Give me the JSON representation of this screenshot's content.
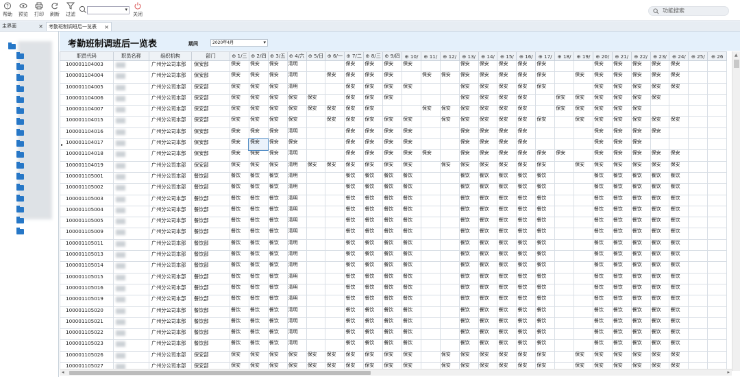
{
  "toolbar": {
    "buttons": [
      {
        "label": "帮助",
        "icon": "help-icon"
      },
      {
        "label": "预览",
        "icon": "eye-icon"
      },
      {
        "label": "打印",
        "icon": "printer-icon"
      },
      {
        "label": "刷新",
        "icon": "refresh-icon"
      },
      {
        "label": "过滤",
        "icon": "filter-icon"
      }
    ],
    "close_label": "关闭",
    "search_value": "",
    "func_search_placeholder": "功能搜索"
  },
  "tabs": [
    {
      "label": "主界面",
      "active": false
    },
    {
      "label": "考勤班制调班后一览表",
      "active": true
    }
  ],
  "page": {
    "title": "考勤班制调班后一览表",
    "filter_label": "期间",
    "filter_value": "2020年4月"
  },
  "columns": [
    "职员代码",
    "职员名称",
    "组织机构",
    "部门",
    "1/三",
    "2/四",
    "3/五",
    "4/六",
    "5/日",
    "6/一",
    "7/二",
    "8/三",
    "9/四",
    "10/",
    "11/",
    "12/",
    "13/",
    "14/",
    "15/",
    "16/",
    "17/",
    "18/",
    "19/",
    "20/",
    "21/",
    "22/",
    "23/",
    "24/",
    "25/",
    "26"
  ],
  "rows": [
    {
      "code": "100001104003",
      "org": "广州分公司本部",
      "dept": "保安部",
      "days": [
        "保安",
        "保安",
        "保安",
        "清明",
        "",
        "",
        "保安",
        "保安",
        "保安",
        "保安",
        "",
        "",
        "保安",
        "保安",
        "保安",
        "保安",
        "保安",
        "",
        "",
        "保安",
        "保安",
        "保安",
        "保安",
        "保安",
        "",
        ""
      ]
    },
    {
      "code": "100001104004",
      "org": "广州分公司本部",
      "dept": "保安部",
      "days": [
        "保安",
        "保安",
        "保安",
        "清明",
        "",
        "保安",
        "保安",
        "保安",
        "保安",
        "",
        "保安",
        "保安",
        "保安",
        "保安",
        "保安",
        "保安",
        "保安",
        "",
        "保安",
        "保安",
        "保安",
        "保安",
        "保安",
        "保安",
        "",
        ""
      ]
    },
    {
      "code": "100001104005",
      "org": "广州分公司本部",
      "dept": "保安部",
      "days": [
        "保安",
        "保安",
        "保安",
        "清明",
        "",
        "",
        "保安",
        "保安",
        "保安",
        "保安",
        "",
        "",
        "保安",
        "保安",
        "保安",
        "保安",
        "保安",
        "",
        "",
        "保安",
        "保安",
        "保安",
        "保安",
        "保安",
        "",
        ""
      ]
    },
    {
      "code": "100001104006",
      "org": "广州分公司本部",
      "dept": "保安部",
      "days": [
        "保安",
        "保安",
        "保安",
        "保安",
        "保安",
        "",
        "保安",
        "保安",
        "保安",
        "",
        "",
        "",
        "保安",
        "保安",
        "保安",
        "保安",
        "",
        "保安",
        "保安",
        "保安",
        "保安",
        "保安",
        "保安",
        "",
        "",
        ""
      ]
    },
    {
      "code": "100001104007",
      "org": "广州分公司本部",
      "dept": "保安部",
      "days": [
        "保安",
        "保安",
        "保安",
        "保安",
        "保安",
        "保安",
        "保安",
        "保安",
        "",
        "",
        "保安",
        "保安",
        "保安",
        "保安",
        "保安",
        "保安",
        "",
        "保安",
        "保安",
        "保安",
        "保安",
        "保安",
        "",
        "",
        "",
        ""
      ]
    },
    {
      "code": "100001104015",
      "org": "广州分公司本部",
      "dept": "保安部",
      "days": [
        "保安",
        "保安",
        "保安",
        "保安",
        "",
        "保安",
        "保安",
        "保安",
        "保安",
        "保安",
        "",
        "保安",
        "保安",
        "保安",
        "保安",
        "保安",
        "保安",
        "",
        "保安",
        "保安",
        "保安",
        "保安",
        "保安",
        "保安",
        "",
        ""
      ]
    },
    {
      "code": "100001104016",
      "org": "广州分公司本部",
      "dept": "保安部",
      "days": [
        "保安",
        "保安",
        "保安",
        "清明",
        "",
        "",
        "保安",
        "保安",
        "保安",
        "保安",
        "",
        "",
        "保安",
        "保安",
        "保安",
        "保安",
        "",
        "",
        "",
        "保安",
        "保安",
        "保安",
        "保安",
        "",
        "",
        ""
      ]
    },
    {
      "code": "100001104017",
      "org": "广州分公司本部",
      "dept": "保安部",
      "days": [
        "保安",
        "保安",
        "保安",
        "保安",
        "",
        "",
        "保安",
        "保安",
        "保安",
        "保安",
        "",
        "",
        "保安",
        "保安",
        "保安",
        "保安",
        "",
        "",
        "",
        "保安",
        "保安",
        "保安",
        "",
        "",
        "",
        ""
      ]
    },
    {
      "code": "100001104018",
      "org": "广州分公司本部",
      "dept": "保安部",
      "days": [
        "保安",
        "保安",
        "保安",
        "清明",
        "",
        "",
        "保安",
        "保安",
        "保安",
        "保安",
        "保安",
        "",
        "保安",
        "保安",
        "保安",
        "保安",
        "保安",
        "保安",
        "",
        "保安",
        "保安",
        "保安",
        "保安",
        "保安",
        "",
        ""
      ]
    },
    {
      "code": "100001104019",
      "org": "广州分公司本部",
      "dept": "保安部",
      "days": [
        "保安",
        "保安",
        "保安",
        "清明",
        "保安",
        "保安",
        "保安",
        "保安",
        "保安",
        "保安",
        "",
        "保安",
        "保安",
        "保安",
        "保安",
        "保安",
        "保安",
        "",
        "保安",
        "保安",
        "保安",
        "保安",
        "保安",
        "保安",
        "",
        ""
      ]
    },
    {
      "code": "100001105001",
      "org": "广州分公司本部",
      "dept": "餐饮部",
      "days": [
        "餐饮",
        "餐饮",
        "餐饮",
        "清明",
        "",
        "",
        "餐饮",
        "餐饮",
        "餐饮",
        "餐饮",
        "",
        "",
        "餐饮",
        "餐饮",
        "餐饮",
        "餐饮",
        "餐饮",
        "",
        "",
        "餐饮",
        "餐饮",
        "餐饮",
        "餐饮",
        "餐饮",
        "",
        ""
      ]
    },
    {
      "code": "100001105002",
      "org": "广州分公司本部",
      "dept": "餐饮部",
      "days": [
        "餐饮",
        "餐饮",
        "餐饮",
        "清明",
        "",
        "",
        "餐饮",
        "餐饮",
        "餐饮",
        "餐饮",
        "",
        "",
        "餐饮",
        "餐饮",
        "餐饮",
        "餐饮",
        "餐饮",
        "",
        "",
        "餐饮",
        "餐饮",
        "餐饮",
        "餐饮",
        "餐饮",
        "",
        ""
      ]
    },
    {
      "code": "100001105003",
      "org": "广州分公司本部",
      "dept": "餐饮部",
      "days": [
        "餐饮",
        "餐饮",
        "餐饮",
        "清明",
        "",
        "",
        "餐饮",
        "餐饮",
        "餐饮",
        "餐饮",
        "",
        "",
        "餐饮",
        "餐饮",
        "餐饮",
        "餐饮",
        "餐饮",
        "",
        "",
        "餐饮",
        "餐饮",
        "餐饮",
        "餐饮",
        "餐饮",
        "",
        ""
      ]
    },
    {
      "code": "100001105004",
      "org": "广州分公司本部",
      "dept": "餐饮部",
      "days": [
        "餐饮",
        "餐饮",
        "餐饮",
        "清明",
        "",
        "",
        "餐饮",
        "餐饮",
        "餐饮",
        "餐饮",
        "",
        "",
        "餐饮",
        "餐饮",
        "餐饮",
        "餐饮",
        "餐饮",
        "",
        "",
        "餐饮",
        "餐饮",
        "餐饮",
        "餐饮",
        "餐饮",
        "",
        ""
      ]
    },
    {
      "code": "100001105005",
      "org": "广州分公司本部",
      "dept": "餐饮部",
      "days": [
        "餐饮",
        "餐饮",
        "餐饮",
        "清明",
        "",
        "",
        "餐饮",
        "餐饮",
        "餐饮",
        "餐饮",
        "",
        "",
        "餐饮",
        "餐饮",
        "餐饮",
        "餐饮",
        "餐饮",
        "",
        "",
        "餐饮",
        "餐饮",
        "餐饮",
        "餐饮",
        "餐饮",
        "",
        ""
      ]
    },
    {
      "code": "100001105009",
      "org": "广州分公司本部",
      "dept": "餐饮部",
      "days": [
        "餐饮",
        "餐饮",
        "餐饮",
        "清明",
        "",
        "",
        "餐饮",
        "餐饮",
        "餐饮",
        "餐饮",
        "",
        "",
        "餐饮",
        "餐饮",
        "餐饮",
        "餐饮",
        "餐饮",
        "",
        "",
        "餐饮",
        "餐饮",
        "餐饮",
        "餐饮",
        "餐饮",
        "",
        ""
      ]
    },
    {
      "code": "100001105011",
      "org": "广州分公司本部",
      "dept": "餐饮部",
      "days": [
        "餐饮",
        "餐饮",
        "餐饮",
        "清明",
        "",
        "",
        "餐饮",
        "餐饮",
        "餐饮",
        "餐饮",
        "",
        "",
        "餐饮",
        "餐饮",
        "餐饮",
        "餐饮",
        "餐饮",
        "",
        "",
        "餐饮",
        "餐饮",
        "餐饮",
        "餐饮",
        "餐饮",
        "",
        ""
      ]
    },
    {
      "code": "100001105013",
      "org": "广州分公司本部",
      "dept": "餐饮部",
      "days": [
        "餐饮",
        "餐饮",
        "餐饮",
        "清明",
        "",
        "",
        "餐饮",
        "餐饮",
        "餐饮",
        "餐饮",
        "",
        "",
        "餐饮",
        "餐饮",
        "餐饮",
        "餐饮",
        "餐饮",
        "",
        "",
        "餐饮",
        "餐饮",
        "餐饮",
        "餐饮",
        "餐饮",
        "",
        ""
      ]
    },
    {
      "code": "100001105014",
      "org": "广州分公司本部",
      "dept": "餐饮部",
      "days": [
        "餐饮",
        "餐饮",
        "餐饮",
        "清明",
        "",
        "",
        "餐饮",
        "餐饮",
        "餐饮",
        "餐饮",
        "",
        "",
        "餐饮",
        "餐饮",
        "餐饮",
        "餐饮",
        "餐饮",
        "",
        "",
        "餐饮",
        "餐饮",
        "餐饮",
        "餐饮",
        "餐饮",
        "",
        ""
      ]
    },
    {
      "code": "100001105015",
      "org": "广州分公司本部",
      "dept": "餐饮部",
      "days": [
        "餐饮",
        "餐饮",
        "餐饮",
        "清明",
        "",
        "",
        "餐饮",
        "餐饮",
        "餐饮",
        "餐饮",
        "",
        "",
        "餐饮",
        "餐饮",
        "餐饮",
        "餐饮",
        "餐饮",
        "",
        "",
        "餐饮",
        "餐饮",
        "餐饮",
        "餐饮",
        "餐饮",
        "",
        ""
      ]
    },
    {
      "code": "100001105016",
      "org": "广州分公司本部",
      "dept": "餐饮部",
      "days": [
        "餐饮",
        "餐饮",
        "餐饮",
        "清明",
        "",
        "",
        "餐饮",
        "餐饮",
        "餐饮",
        "餐饮",
        "",
        "",
        "餐饮",
        "餐饮",
        "餐饮",
        "餐饮",
        "餐饮",
        "",
        "",
        "餐饮",
        "餐饮",
        "餐饮",
        "餐饮",
        "餐饮",
        "",
        ""
      ]
    },
    {
      "code": "100001105019",
      "org": "广州分公司本部",
      "dept": "餐饮部",
      "days": [
        "餐饮",
        "餐饮",
        "餐饮",
        "清明",
        "",
        "",
        "餐饮",
        "餐饮",
        "餐饮",
        "餐饮",
        "",
        "",
        "餐饮",
        "餐饮",
        "餐饮",
        "餐饮",
        "餐饮",
        "",
        "",
        "餐饮",
        "餐饮",
        "餐饮",
        "餐饮",
        "餐饮",
        "",
        ""
      ]
    },
    {
      "code": "100001105020",
      "org": "广州分公司本部",
      "dept": "餐饮部",
      "days": [
        "餐饮",
        "餐饮",
        "餐饮",
        "清明",
        "",
        "",
        "餐饮",
        "餐饮",
        "餐饮",
        "餐饮",
        "",
        "",
        "餐饮",
        "餐饮",
        "餐饮",
        "餐饮",
        "餐饮",
        "",
        "",
        "餐饮",
        "餐饮",
        "餐饮",
        "餐饮",
        "餐饮",
        "",
        ""
      ]
    },
    {
      "code": "100001105021",
      "org": "广州分公司本部",
      "dept": "餐饮部",
      "days": [
        "餐饮",
        "餐饮",
        "餐饮",
        "清明",
        "",
        "",
        "餐饮",
        "餐饮",
        "餐饮",
        "餐饮",
        "",
        "",
        "餐饮",
        "餐饮",
        "餐饮",
        "餐饮",
        "餐饮",
        "",
        "",
        "餐饮",
        "餐饮",
        "餐饮",
        "餐饮",
        "餐饮",
        "",
        ""
      ]
    },
    {
      "code": "100001105022",
      "org": "广州分公司本部",
      "dept": "餐饮部",
      "days": [
        "餐饮",
        "餐饮",
        "餐饮",
        "清明",
        "",
        "",
        "餐饮",
        "餐饮",
        "餐饮",
        "餐饮",
        "",
        "",
        "餐饮",
        "餐饮",
        "餐饮",
        "餐饮",
        "餐饮",
        "",
        "",
        "餐饮",
        "餐饮",
        "餐饮",
        "餐饮",
        "餐饮",
        "",
        ""
      ]
    },
    {
      "code": "100001105023",
      "org": "广州分公司本部",
      "dept": "餐饮部",
      "days": [
        "餐饮",
        "餐饮",
        "餐饮",
        "清明",
        "",
        "",
        "餐饮",
        "餐饮",
        "餐饮",
        "餐饮",
        "",
        "",
        "餐饮",
        "餐饮",
        "餐饮",
        "餐饮",
        "餐饮",
        "",
        "",
        "餐饮",
        "餐饮",
        "餐饮",
        "餐饮",
        "餐饮",
        "",
        ""
      ]
    },
    {
      "code": "100001105026",
      "org": "广州分公司本部",
      "dept": "保安部",
      "days": [
        "保安",
        "保安",
        "保安",
        "保安",
        "保安",
        "保安",
        "保安",
        "保安",
        "保安",
        "保安",
        "",
        "保安",
        "保安",
        "保安",
        "保安",
        "保安",
        "保安",
        "",
        "保安",
        "保安",
        "保安",
        "保安",
        "保安",
        "保安",
        "",
        ""
      ]
    },
    {
      "code": "100001105027",
      "org": "广州分公司本部",
      "dept": "保安部",
      "days": [
        "保安",
        "保安",
        "保安",
        "保安",
        "保安",
        "保安",
        "保安",
        "保安",
        "保安",
        "保安",
        "",
        "保安",
        "保安",
        "保安",
        "保安",
        "保安",
        "保安",
        "",
        "保安",
        "保安",
        "保安",
        "保安",
        "保安",
        "保安",
        "",
        ""
      ]
    }
  ],
  "selected_row": 7,
  "selected_day": 1
}
